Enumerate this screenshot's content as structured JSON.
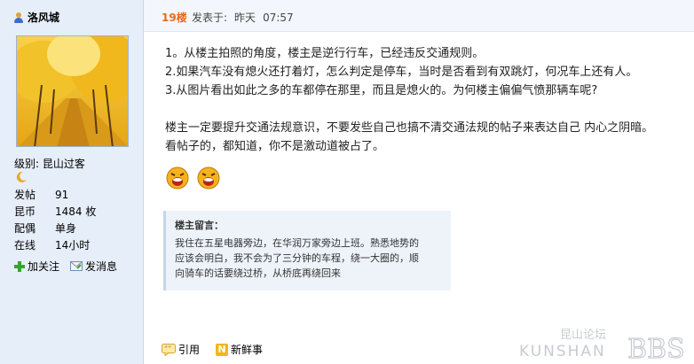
{
  "user": {
    "name": "洛风城",
    "level_label": "级别: 昆山过客",
    "stats": [
      {
        "label": "发帖",
        "value": "91"
      },
      {
        "label": "昆币",
        "value": "1484 枚"
      },
      {
        "label": "配偶",
        "value": "单身"
      },
      {
        "label": "在线",
        "value": "14小时"
      }
    ],
    "actions": {
      "follow": "加关注",
      "message": "发消息"
    }
  },
  "post": {
    "floor": "19楼",
    "posted_label": "发表于:",
    "date": "昨天",
    "time": "07:57",
    "lines": [
      "1。从楼主拍照的角度，楼主是逆行行车，已经违反交通规则。",
      "2.如果汽车没有熄火还打着灯，怎么判定是停车，当时是否看到有双跳灯，何况车上还有人。",
      "3.从图片看出如此之多的车都停在那里，而且是熄火的。为何楼主偏偏气愤那辆车呢?",
      "楼主一定要提升交通法规意识，不要发些自己也搞不清交通法规的帖子来表达自己 内心之阴暗。",
      "看帖子的，都知道，你不是激动道被占了。"
    ],
    "reply_note": {
      "title": "楼主留言：",
      "lines": [
        "我住在五星电器旁边，在华润万家旁边上班。熟悉地势的",
        "应该会明白，我不会为了三分钟的车程，绕一大圈的，顺",
        "向骑车的话要绕过桥，从桥底再绕回来"
      ]
    }
  },
  "footer": {
    "quote": "引用",
    "fresh": "新鲜事"
  },
  "watermark": {
    "cn": "昆山论坛",
    "en": "KUNSHAN",
    "bbs": "BBS"
  },
  "colors": {
    "floor": "#e46b1d",
    "sidebar_bg": "#e6eef9",
    "quote_bg": "#eef3fa"
  }
}
